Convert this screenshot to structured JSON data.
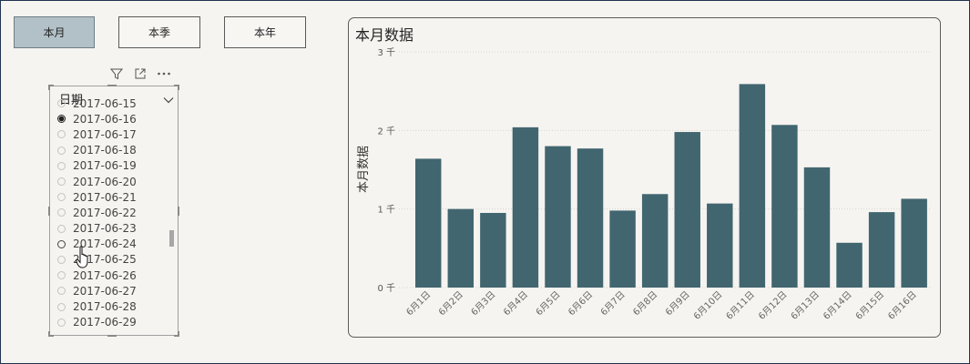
{
  "buttons": [
    {
      "label": "本月",
      "active": true
    },
    {
      "label": "本季",
      "active": false
    },
    {
      "label": "本年",
      "active": false
    }
  ],
  "slicer": {
    "title": "日期",
    "items": [
      "2017-06-15",
      "2017-06-16",
      "2017-06-17",
      "2017-06-18",
      "2017-06-19",
      "2017-06-20",
      "2017-06-21",
      "2017-06-22",
      "2017-06-23",
      "2017-06-24",
      "2017-06-25",
      "2017-06-26",
      "2017-06-27",
      "2017-06-28",
      "2017-06-29"
    ],
    "selected": "2017-06-16",
    "toolbar_icons": [
      "filter-icon",
      "focus-mode-icon",
      "more-options-icon"
    ]
  },
  "colors": {
    "bar": "#416670",
    "active_button": "#b2c1c7",
    "background": "#f6f4f0"
  },
  "chart": {
    "title": "本月数据"
  },
  "chart_data": {
    "type": "bar",
    "title": "本月数据",
    "xlabel": "",
    "ylabel": "本月数据",
    "categories": [
      "6月1日",
      "6月2日",
      "6月3日",
      "6月4日",
      "6月5日",
      "6月6日",
      "6月7日",
      "6月8日",
      "6月9日",
      "6月10日",
      "6月11日",
      "6月12日",
      "6月13日",
      "6月14日",
      "6月15日",
      "6月16日"
    ],
    "values": [
      1640,
      1000,
      950,
      2040,
      1800,
      1770,
      980,
      1190,
      1980,
      1070,
      2590,
      2070,
      1530,
      570,
      960,
      1130
    ],
    "ylim": [
      0,
      3000
    ],
    "yticks": [
      0,
      1000,
      2000,
      3000
    ],
    "ytick_labels": [
      "0 千",
      "1 千",
      "2 千",
      "3 千"
    ],
    "grid": true,
    "legend": "none"
  }
}
